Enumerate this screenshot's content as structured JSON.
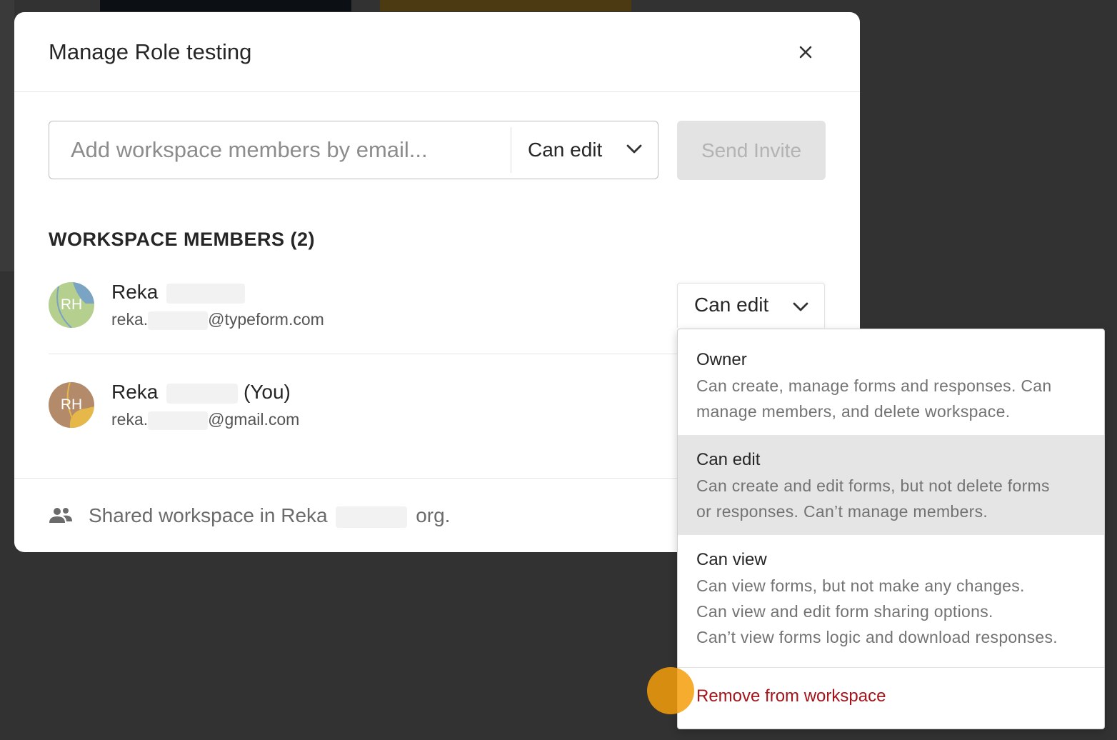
{
  "modal": {
    "title": "Manage Role testing"
  },
  "invite": {
    "placeholder": "Add workspace members by email...",
    "role_label": "Can edit",
    "send_label": "Send Invite"
  },
  "members_section": {
    "title": "WORKSPACE MEMBERS (2)"
  },
  "members": [
    {
      "initials": "RH",
      "name": "Reka",
      "name_suffix": "",
      "email_prefix": "reka.",
      "email_domain": "@typeform.com",
      "role": "Can edit",
      "avatar_color": "#b5cf8e"
    },
    {
      "initials": "RH",
      "name": "Reka",
      "name_suffix": "(You)",
      "email_prefix": "reka.",
      "email_domain": "@gmail.com",
      "avatar_color": "#b38a6a"
    }
  ],
  "footer": {
    "text_before": "Shared workspace in Reka",
    "text_after": "org."
  },
  "role_menu": {
    "options": [
      {
        "title": "Owner",
        "desc_lines": [
          "Can create, manage forms and responses. Can",
          "manage members, and delete workspace."
        ]
      },
      {
        "title": "Can edit",
        "desc_lines": [
          "Can create and edit forms, but not delete forms",
          "or responses. Can’t manage members."
        ]
      },
      {
        "title": "Can view",
        "desc_lines": [
          "Can view forms, but not make any changes.",
          "Can view and edit form sharing options.",
          "Can’t view forms logic and download responses."
        ]
      }
    ],
    "remove_label": "Remove from workspace",
    "remove_color": "#a5141a",
    "selected": "Can edit"
  },
  "icons": {
    "close": "close-icon",
    "chevron": "chevron-down-icon",
    "people": "people-icon"
  }
}
